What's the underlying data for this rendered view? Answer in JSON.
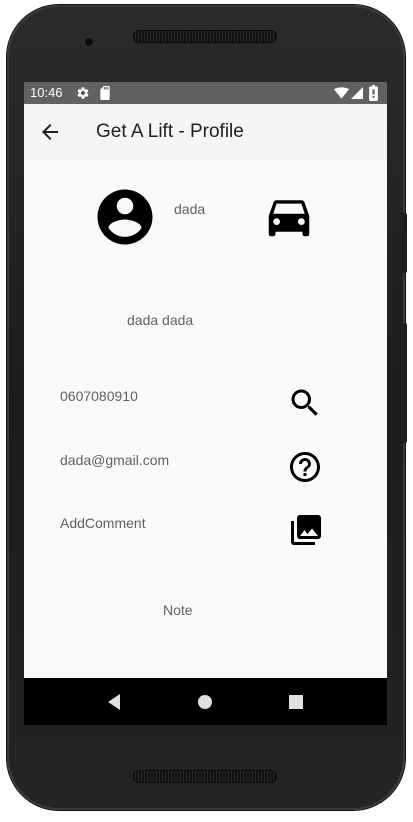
{
  "status_bar": {
    "time": "10:46",
    "icons": [
      "gear-icon",
      "sd-card-icon",
      "wifi-icon",
      "signal-icon",
      "battery-icon"
    ]
  },
  "app_bar": {
    "title": "Get A Lift - Profile",
    "back_icon": "arrow-back-icon"
  },
  "profile": {
    "avatar_icon": "account-circle-icon",
    "username": "dada",
    "car_icon": "car-icon",
    "full_name": "dada dada",
    "phone": "0607080910",
    "email": "dada@gmail.com",
    "comment": "AddComment",
    "note": "Note"
  },
  "actions": {
    "search_icon": "search-icon",
    "help_icon": "help-outline-icon",
    "photo_library_icon": "photo-library-icon"
  },
  "nav_bar": {
    "buttons": [
      "back-triangle-icon",
      "home-circle-icon",
      "recents-square-icon"
    ]
  },
  "colors": {
    "status_bar": "#616161",
    "app_bar": "#f5f5f5",
    "background": "#fafafa",
    "text_secondary": "#616161",
    "icon": "#000000"
  }
}
